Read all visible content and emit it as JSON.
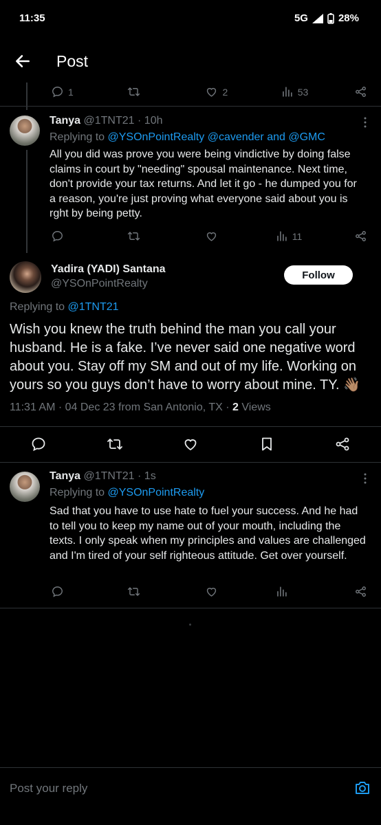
{
  "status": {
    "time": "11:35",
    "network": "5G",
    "battery": "28%"
  },
  "header": {
    "title": "Post"
  },
  "prev_tweet_actions": {
    "replies": "1",
    "retweets": "",
    "likes": "2",
    "views": "53"
  },
  "reply1": {
    "name": "Tanya",
    "handle": "@1TNT21",
    "time": "· 10h",
    "replying_label": "Replying to",
    "replying_to": "@YSOnPointRealty @cavender and @GMC",
    "text": "All you did was prove you were being vindictive by doing false claims in court by \"needing\" spousal maintenance. Next time, don't provide your tax returns. And let it go - he dumped you for a reason, you're just proving what everyone said about you is rght by being petty.",
    "views": "11"
  },
  "main": {
    "name": "Yadira (YADI) Santana",
    "handle": "@YSOnPointRealty",
    "follow_label": "Follow",
    "replying_label": "Replying to",
    "replying_to": "@1TNT21",
    "text": "Wish you knew the truth behind the man you call your husband. He is a fake. I’ve never said one negative word about you. Stay off my SM and out of my life. Working on yours so you guys don’t have to worry about mine. TY. 👋🏽",
    "meta": "11:31 AM · 04 Dec 23 from San Antonio, TX · ",
    "views_count": "2",
    "views_label": " Views"
  },
  "reply2": {
    "name": "Tanya",
    "handle": "@1TNT21",
    "time": "· 1s",
    "replying_label": "Replying to",
    "replying_to": "@YSOnPointRealty",
    "text": "Sad that you have to use hate to fuel your success. And he had to tell you to keep my name out of your mouth, including the texts. I only speak when my principles and values are challenged and I'm tired of your self righteous attitude. Get over yourself."
  },
  "composer": {
    "placeholder": "Post your reply"
  },
  "colors": {
    "background": "#000000",
    "text": "#e7e9ea",
    "muted": "#71767b",
    "link": "#1d9bf0",
    "divider": "#2f3336"
  }
}
